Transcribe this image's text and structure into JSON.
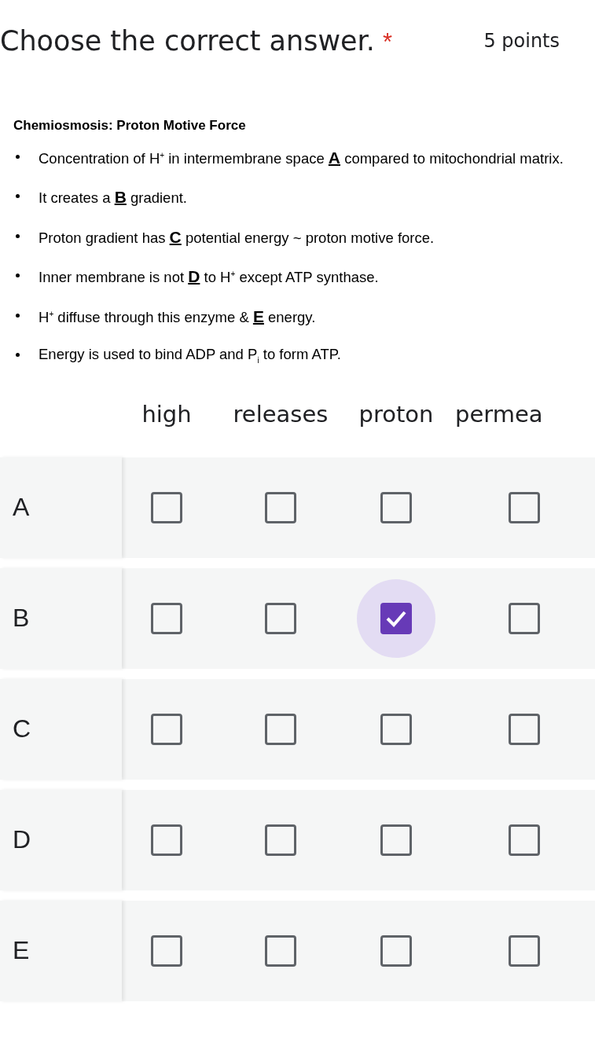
{
  "question": {
    "title": "Choose the correct answer.",
    "required_mark": "*",
    "points": "5 points"
  },
  "image_text": {
    "heading": "Chemiosmosis: Proton Motive Force",
    "bullets": [
      "Concentration of H$^{+}$ in intermembrane space **A** compared to mitochondrial matrix.",
      "It creates a **B** gradient.",
      "Proton gradient has **C** potential energy ~ proton motive force.",
      "Inner membrane is not **D** to H$^{+}$ except ATP synthase.",
      "H$^{+}$ diffuse through this enzyme & **E** energy.",
      "Energy is used to bind ADP and P$_{i}$ to form ATP."
    ]
  },
  "grid": {
    "columns": [
      "high",
      "releases",
      "proton",
      "permea"
    ],
    "rows": [
      {
        "label": "A",
        "choices": [
          {
            "checked": false
          },
          {
            "checked": false
          },
          {
            "checked": false
          },
          {
            "checked": false
          }
        ]
      },
      {
        "label": "B",
        "choices": [
          {
            "checked": false
          },
          {
            "checked": false
          },
          {
            "checked": true
          },
          {
            "checked": false
          }
        ]
      },
      {
        "label": "C",
        "choices": [
          {
            "checked": false
          },
          {
            "checked": false
          },
          {
            "checked": false
          },
          {
            "checked": false
          }
        ]
      },
      {
        "label": "D",
        "choices": [
          {
            "checked": false
          },
          {
            "checked": false
          },
          {
            "checked": false
          },
          {
            "checked": false
          }
        ]
      },
      {
        "label": "E",
        "choices": [
          {
            "checked": false
          },
          {
            "checked": false
          },
          {
            "checked": false
          },
          {
            "checked": false
          }
        ]
      }
    ]
  }
}
